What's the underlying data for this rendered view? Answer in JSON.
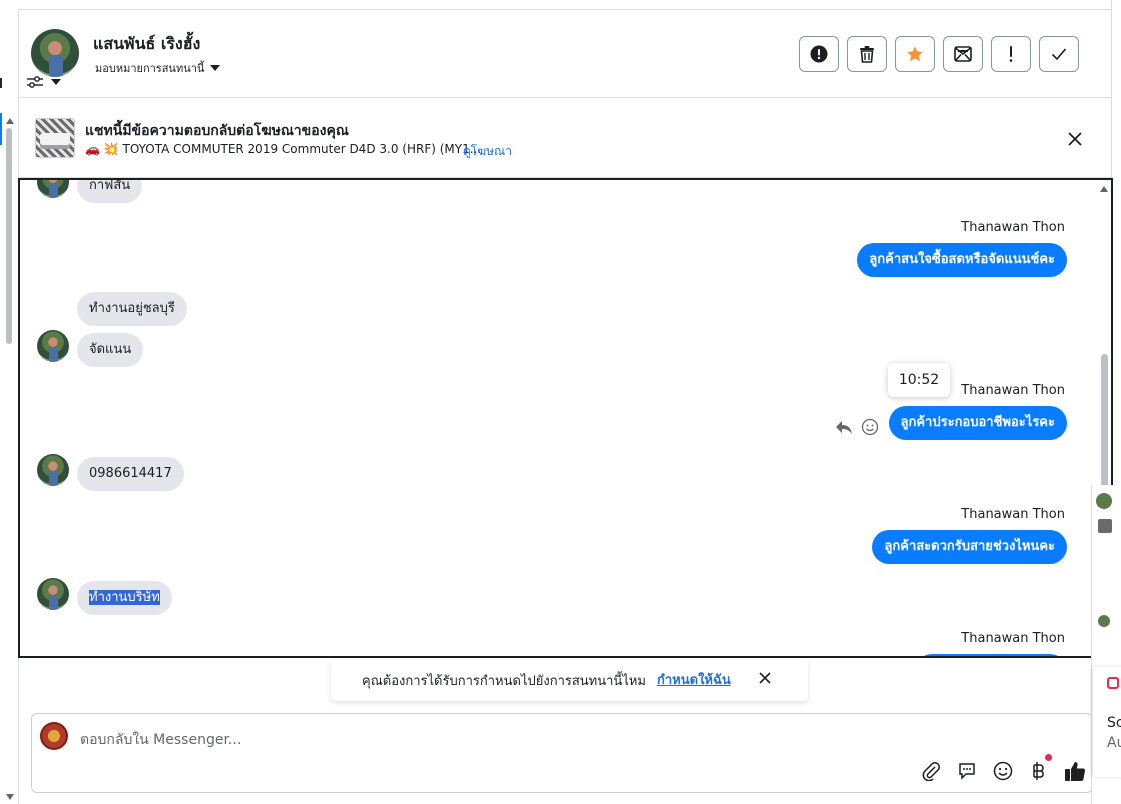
{
  "contact": {
    "name": "แสนพันธ์ เริงฮั้ง",
    "assign_label": "มอบหมายการสนทนานี้"
  },
  "header_actions": [
    {
      "icon": "alert-circle-icon"
    },
    {
      "icon": "trash-icon"
    },
    {
      "icon": "star-icon",
      "color": "#f7923b"
    },
    {
      "icon": "mark-unread-icon"
    },
    {
      "icon": "exclamation-icon"
    },
    {
      "icon": "checkmark-icon"
    }
  ],
  "ad_banner": {
    "title": "แชทนี้มีข้อความตอบกลับต่อโฆษณาของคุณ",
    "subtitle": "🚗 💥 TOYOTA COMMUTER 2019 Commuter D4D 3.0 (HRF) (MY1...",
    "link": "ดูโฆษณา"
  },
  "messages": {
    "m1": "กาฟสัน",
    "s1": "Thanawan Thon",
    "o1": "ลูกค้าสนใจซื้อสดหรือจัดแนนช์คะ",
    "m2": "ทำงานอยู่ชลบุรี",
    "m3": "จัดแนน",
    "tooltip_time": "10:52",
    "s2": "Thanawan Thon",
    "o2": "ลูกค้าประกอบอาชีพอะไรคะ",
    "m4": "0986614417",
    "s3": "Thanawan Thon",
    "o3": "ลูกค้าสะดวกรับสายช่วงไหนคะ",
    "m5": "ทำงานบริษัท",
    "s4": "Thanawan Thon"
  },
  "toast": {
    "text": "คุณต้องการได้รับการกำหนดไปยังการสนทนานี้ไหม",
    "link": "กำหนดให้ฉัน"
  },
  "composer": {
    "placeholder": "ตอบกลับใน Messenger..."
  },
  "side_panel": {
    "line1": "Sc",
    "line2": "Au"
  },
  "colors": {
    "outgoing_bubble": "#0a7cff",
    "incoming_bubble": "#e4e6eb",
    "link": "#216fdb",
    "selection": "#3367d6"
  }
}
